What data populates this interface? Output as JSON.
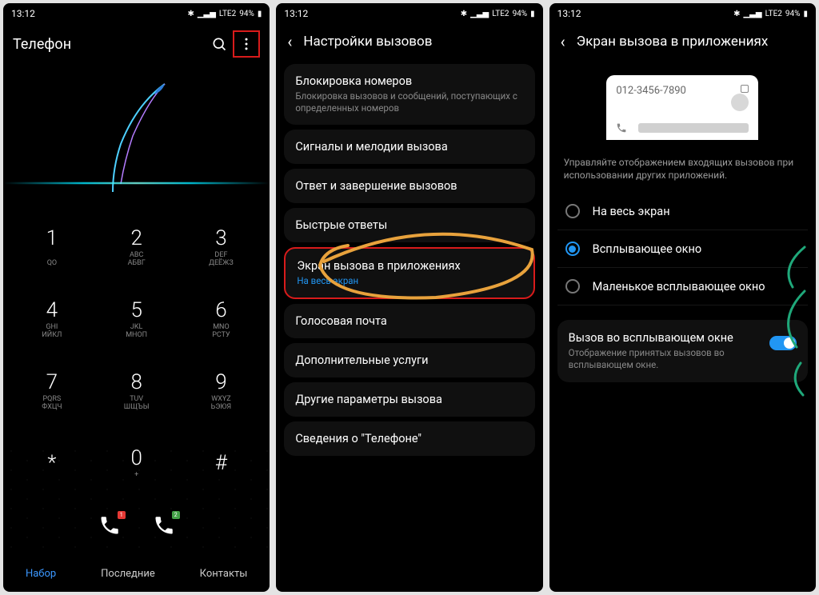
{
  "status": {
    "time": "13:12",
    "battery": "94%"
  },
  "screen1": {
    "title": "Телефон",
    "keys": [
      {
        "num": "1",
        "letters": "\nQO"
      },
      {
        "num": "2",
        "letters": "ABC\nАБВГ"
      },
      {
        "num": "3",
        "letters": "DEF\nДЕЁЖЗ"
      },
      {
        "num": "4",
        "letters": "GHI\nИЙКЛ"
      },
      {
        "num": "5",
        "letters": "JKL\nМНОП"
      },
      {
        "num": "6",
        "letters": "MNO\nРСТУ"
      },
      {
        "num": "7",
        "letters": "PQRS\nФХЦЧ"
      },
      {
        "num": "8",
        "letters": "TUV\nШЩЪЫ"
      },
      {
        "num": "9",
        "letters": "WXYZ\nЬЭЮЯ"
      },
      {
        "num": "*",
        "letters": ""
      },
      {
        "num": "0",
        "letters": "+"
      },
      {
        "num": "#",
        "letters": ""
      }
    ],
    "sim1_badge": "1",
    "sim2_badge": "2",
    "tabs": {
      "dial": "Набор",
      "recent": "Последние",
      "contacts": "Контакты"
    }
  },
  "screen2": {
    "header": "Настройки вызовов",
    "items": [
      {
        "t": "Блокировка номеров",
        "s": "Блокировка вызовов и сообщений, поступающих с определенных номеров"
      },
      {
        "t": "Сигналы и мелодии вызова"
      },
      {
        "t": "Ответ и завершение вызовов"
      },
      {
        "t": "Быстрые ответы"
      },
      {
        "t": "Экран вызова в приложениях",
        "s": "На весь экран",
        "blue": true,
        "hl": true
      },
      {
        "t": "Голосовая почта"
      },
      {
        "t": "Дополнительные услуги"
      },
      {
        "t": "Другие параметры вызова"
      },
      {
        "t": "Сведения о \"Телефоне\""
      }
    ]
  },
  "screen3": {
    "header": "Экран вызова в приложениях",
    "mock_number": "012-3456-7890",
    "desc": "Управляйте отображением входящих вызовов при использовании других приложений.",
    "options": [
      {
        "label": "На весь экран",
        "on": false
      },
      {
        "label": "Всплывающее окно",
        "on": true
      },
      {
        "label": "Маленькое всплывающее окно",
        "on": false
      }
    ],
    "switch": {
      "t": "Вызов во всплывающем окне",
      "s": "Отображение принятых вызовов во всплывающем окне."
    }
  }
}
